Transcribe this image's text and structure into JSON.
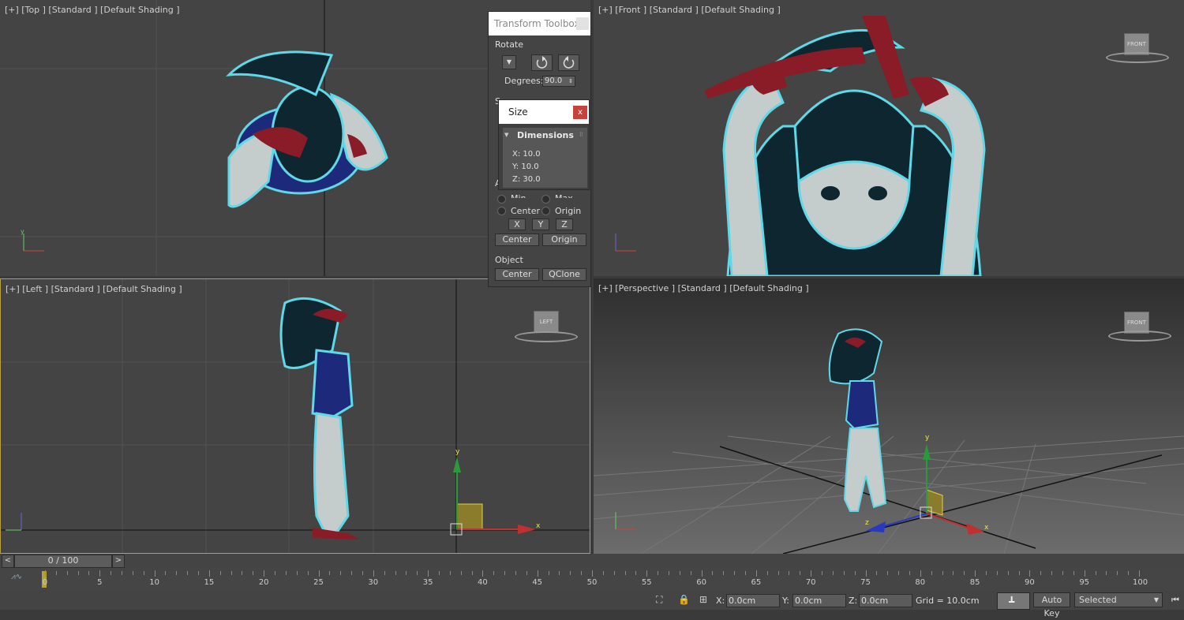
{
  "viewports": {
    "top": {
      "label": "[+] [Top ] [Standard ] [Default Shading ]"
    },
    "front": {
      "label": "[+] [Front ] [Standard ] [Default Shading ]",
      "cube": "FRONT"
    },
    "left": {
      "label": "[+] [Left ] [Standard ] [Default Shading ]",
      "cube": "LEFT"
    },
    "perspective": {
      "label": "[+] [Perspective ] [Standard ] [Default Shading ]",
      "cube": "FRONT"
    }
  },
  "gizmo": {
    "x": "x",
    "y": "y",
    "z": "z"
  },
  "toolbox": {
    "title": "Transform Toolbox",
    "rotate": {
      "section": "Rotate",
      "degrees_label": "Degrees:",
      "degrees_value": "90.0"
    },
    "size_section_partial": "S",
    "align_section_partial": "A",
    "align": {
      "min": "Min",
      "max": "Max",
      "center": "Center",
      "origin": "Origin",
      "x": "X",
      "y": "Y",
      "z": "Z",
      "center_btn": "Center",
      "origin_btn": "Origin"
    },
    "object": {
      "section": "Object",
      "center_btn": "Center",
      "qclone_btn": "QClone"
    }
  },
  "size_dialog": {
    "title": "Size",
    "close": "x",
    "dimensions": {
      "header": "Dimensions",
      "x": "X:   10.0",
      "y": "Y:   10.0",
      "z": "Z:   30.0"
    }
  },
  "timeline": {
    "frame": "0 / 100",
    "ticks": [
      "0",
      "5",
      "10",
      "15",
      "20",
      "25",
      "30",
      "35",
      "40",
      "45",
      "50",
      "55",
      "60",
      "65",
      "70",
      "75",
      "80",
      "85",
      "90",
      "95",
      "100"
    ]
  },
  "status": {
    "x_label": "X:",
    "x_value": "0.0cm",
    "y_label": "Y:",
    "y_value": "0.0cm",
    "z_label": "Z:",
    "z_value": "0.0cm",
    "grid": "Grid = 10.0cm",
    "auto_key": "Auto Key",
    "selected": "Selected"
  },
  "colors": {
    "outline": "#5fd8e8",
    "dress": "#1d2a7c",
    "skin": "#c4cccc",
    "hair": "#0e2630",
    "ribbon": "#8a1c28"
  }
}
